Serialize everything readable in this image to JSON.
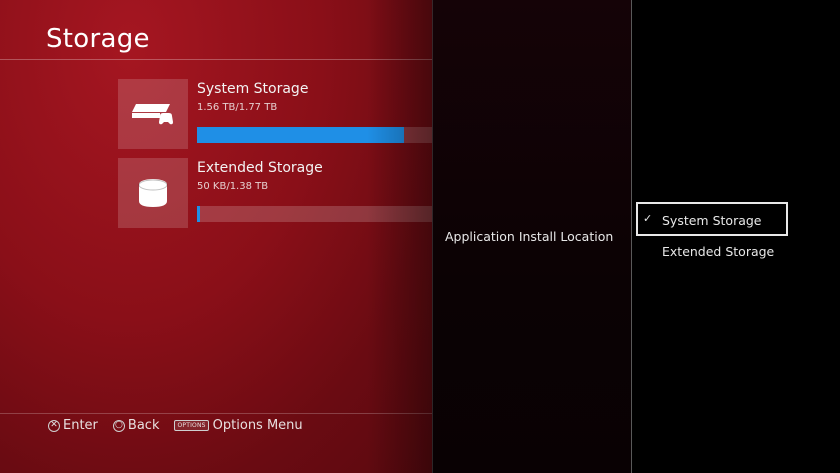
{
  "screen": {
    "title": "Storage"
  },
  "storage_items": [
    {
      "name": "System Storage",
      "usage": "1.56 TB/1.77 TB",
      "fill_fraction": 0.88,
      "icon": "console-icon"
    },
    {
      "name": "Extended Storage",
      "usage": "50 KB/1.38 TB",
      "fill_fraction": 0.01,
      "icon": "external-drive-icon"
    }
  ],
  "footer": {
    "enter_label": "Enter",
    "back_label": "Back",
    "options_badge": "OPTIONS",
    "options_label": "Options Menu"
  },
  "submenu": {
    "label": "Application Install Location"
  },
  "options_menu": {
    "items": [
      {
        "label": "System Storage",
        "selected": true
      },
      {
        "label": "Extended Storage",
        "selected": false
      }
    ]
  },
  "colors": {
    "accent_bar": "#1f8fe6",
    "panel_red": "#8a0f18"
  }
}
